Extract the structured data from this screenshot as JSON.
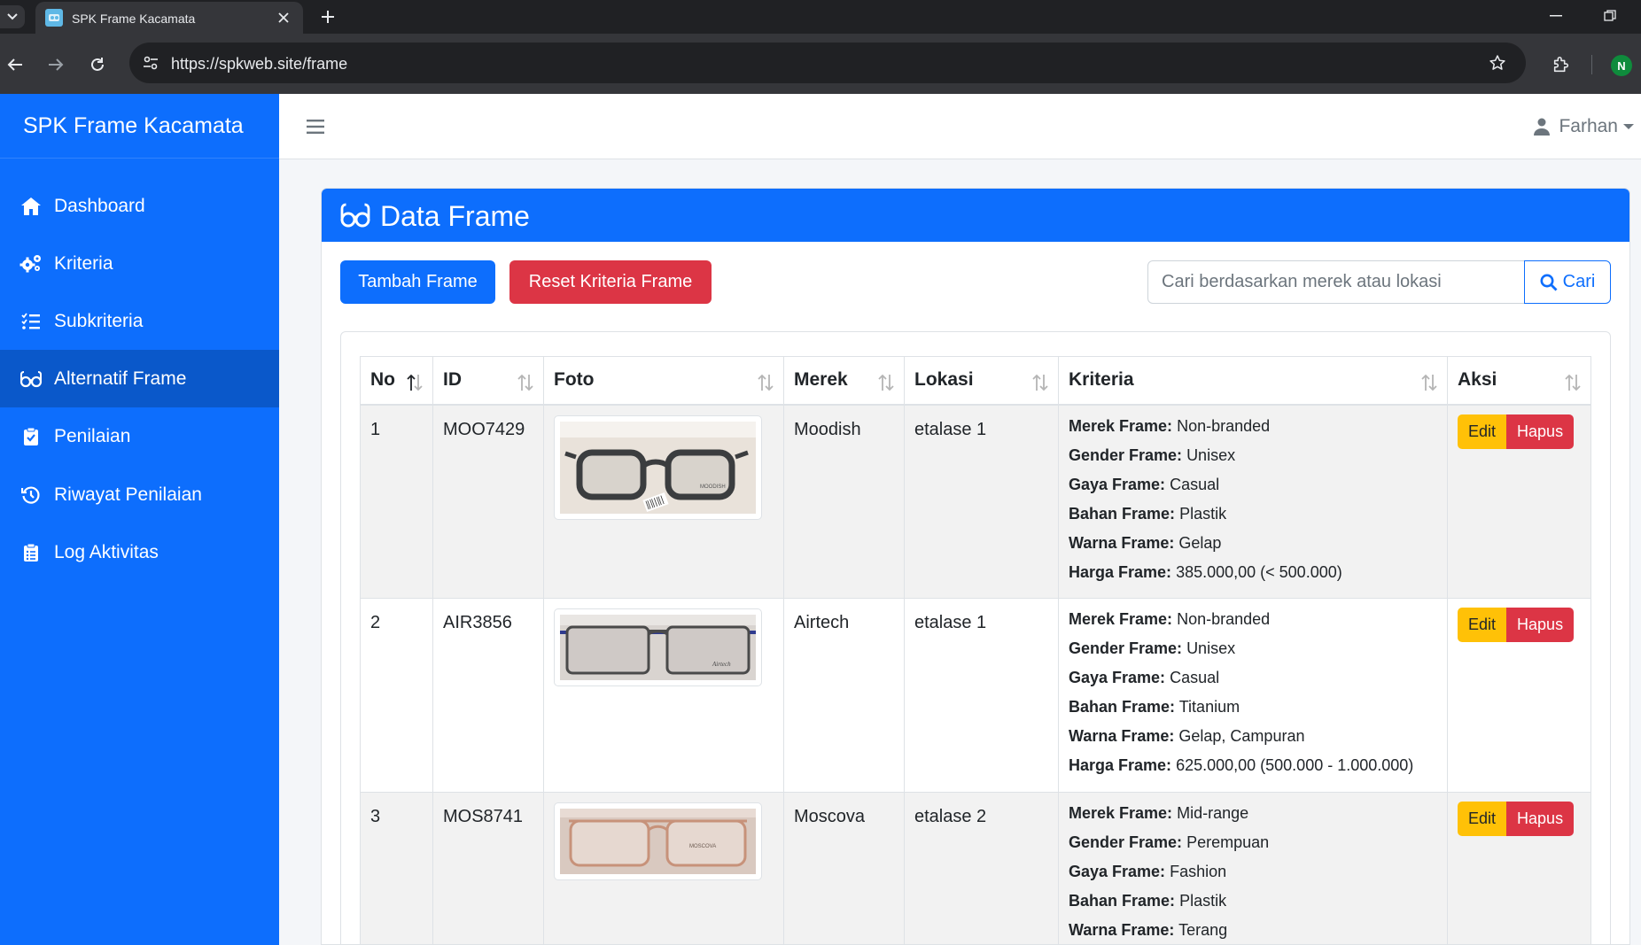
{
  "browser": {
    "tab_title": "SPK Frame Kacamata",
    "url": "https://spkweb.site/frame",
    "profile_initial": "N"
  },
  "sidebar": {
    "brand": "SPK Frame Kacamata",
    "items": [
      {
        "label": "Dashboard",
        "icon": "home-icon"
      },
      {
        "label": "Kriteria",
        "icon": "gears-icon"
      },
      {
        "label": "Subkriteria",
        "icon": "list-check-icon"
      },
      {
        "label": "Alternatif Frame",
        "icon": "glasses-icon",
        "active": true
      },
      {
        "label": "Penilaian",
        "icon": "clipboard-check-icon"
      },
      {
        "label": "Riwayat Penilaian",
        "icon": "history-icon"
      },
      {
        "label": "Log Aktivitas",
        "icon": "clipboard-list-icon"
      }
    ]
  },
  "topbar": {
    "user_name": "Farhan"
  },
  "page": {
    "title": "Data Frame",
    "add_button": "Tambah Frame",
    "reset_button": "Reset Kriteria Frame",
    "search_placeholder": "Cari berdasarkan merek atau lokasi",
    "search_button": "Cari"
  },
  "table": {
    "headers": [
      "No",
      "ID",
      "Foto",
      "Merek",
      "Lokasi",
      "Kriteria",
      "Aksi"
    ],
    "edit_label": "Edit",
    "delete_label": "Hapus",
    "rows": [
      {
        "no": "1",
        "id": "MOO7429",
        "merek": "Moodish",
        "lokasi": "etalase 1",
        "photo_label": "MOODISH",
        "kriteria": [
          {
            "k": "Merek Frame:",
            "v": "Non-branded"
          },
          {
            "k": "Gender Frame:",
            "v": "Unisex"
          },
          {
            "k": "Gaya Frame:",
            "v": "Casual"
          },
          {
            "k": "Bahan Frame:",
            "v": "Plastik"
          },
          {
            "k": "Warna Frame:",
            "v": "Gelap"
          },
          {
            "k": "Harga Frame:",
            "v": "385.000,00 (< 500.000)"
          }
        ]
      },
      {
        "no": "2",
        "id": "AIR3856",
        "merek": "Airtech",
        "lokasi": "etalase 1",
        "photo_label": "Airtech",
        "kriteria": [
          {
            "k": "Merek Frame:",
            "v": "Non-branded"
          },
          {
            "k": "Gender Frame:",
            "v": "Unisex"
          },
          {
            "k": "Gaya Frame:",
            "v": "Casual"
          },
          {
            "k": "Bahan Frame:",
            "v": "Titanium"
          },
          {
            "k": "Warna Frame:",
            "v": "Gelap, Campuran"
          },
          {
            "k": "Harga Frame:",
            "v": "625.000,00 (500.000 - 1.000.000)"
          }
        ]
      },
      {
        "no": "3",
        "id": "MOS8741",
        "merek": "Moscova",
        "lokasi": "etalase 2",
        "photo_label": "MOSCOVA",
        "kriteria": [
          {
            "k": "Merek Frame:",
            "v": "Mid-range"
          },
          {
            "k": "Gender Frame:",
            "v": "Perempuan"
          },
          {
            "k": "Gaya Frame:",
            "v": "Fashion"
          },
          {
            "k": "Bahan Frame:",
            "v": "Plastik"
          },
          {
            "k": "Warna Frame:",
            "v": "Terang"
          }
        ]
      }
    ]
  }
}
